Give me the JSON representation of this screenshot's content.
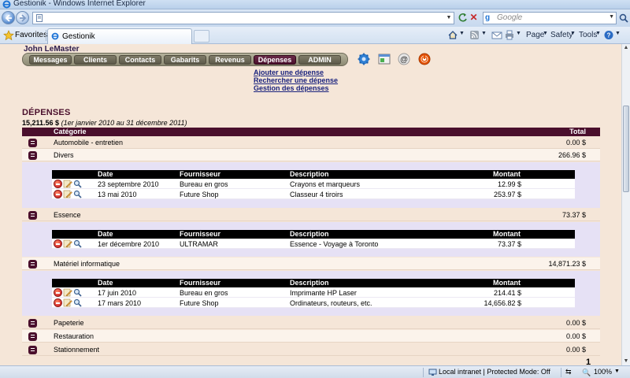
{
  "browser": {
    "title": "Gestionik - Windows Internet Explorer",
    "search_placeholder": "Google",
    "favorites_label": "Favorites",
    "tab_label": "Gestionik",
    "commands": {
      "page": "Page",
      "safety": "Safety",
      "tools": "Tools"
    },
    "status_zone": "Local intranet | Protected Mode: Off",
    "zoom": "100%"
  },
  "app": {
    "user": "John LeMaster",
    "menu": [
      "Messages",
      "Clients",
      "Contacts",
      "Gabarits",
      "Revenus",
      "Dépenses",
      "ADMIN"
    ],
    "active_menu": "Dépenses",
    "sub_links": [
      "Ajouter une dépense",
      "Rechercher une dépense",
      "Gestion des dépenses"
    ],
    "section_title": "DÉPENSES",
    "grand_total": "15,211.56 $",
    "period": "(1er janvier 2010 au 31 décembre 2011)",
    "table_headers": {
      "category": "Catégorie",
      "total": "Total"
    },
    "detail_headers": {
      "date": "Date",
      "supplier": "Fournisseur",
      "description": "Description",
      "amount": "Montant"
    },
    "categories": [
      {
        "name": "Automobile - entretien",
        "total": "0.00 $"
      },
      {
        "name": "Divers",
        "total": "266.96 $",
        "items": [
          {
            "date": "23 septembre 2010",
            "supplier": "Bureau en gros",
            "description": "Crayons et marqueurs",
            "amount": "12.99 $"
          },
          {
            "date": "13 mai 2010",
            "supplier": "Future Shop",
            "description": "Classeur 4 tiroirs",
            "amount": "253.97 $"
          }
        ]
      },
      {
        "name": "Essence",
        "total": "73.37 $",
        "items": [
          {
            "date": "1er décembre 2010",
            "supplier": "ULTRAMAR",
            "description": "Essence - Voyage à Toronto",
            "amount": "73.37 $"
          }
        ]
      },
      {
        "name": "Matériel informatique",
        "total": "14,871.23 $",
        "items": [
          {
            "date": "17 juin 2010",
            "supplier": "Bureau en gros",
            "description": "Imprimante HP Laser",
            "amount": "214.41 $"
          },
          {
            "date": "17 mars 2010",
            "supplier": "Future Shop",
            "description": "Ordinateurs, routeurs, etc.",
            "amount": "14,656.82 $"
          }
        ]
      },
      {
        "name": "Papeterie",
        "total": "0.00 $"
      },
      {
        "name": "Restauration",
        "total": "0.00 $"
      },
      {
        "name": "Stationnement",
        "total": "0.00 $"
      }
    ],
    "page_number": "1"
  },
  "colors": {
    "accent": "#4a0f2c",
    "page_bg": "#f5e6d8",
    "detail_bg": "#e6e1f5",
    "link": "#1a237e"
  }
}
